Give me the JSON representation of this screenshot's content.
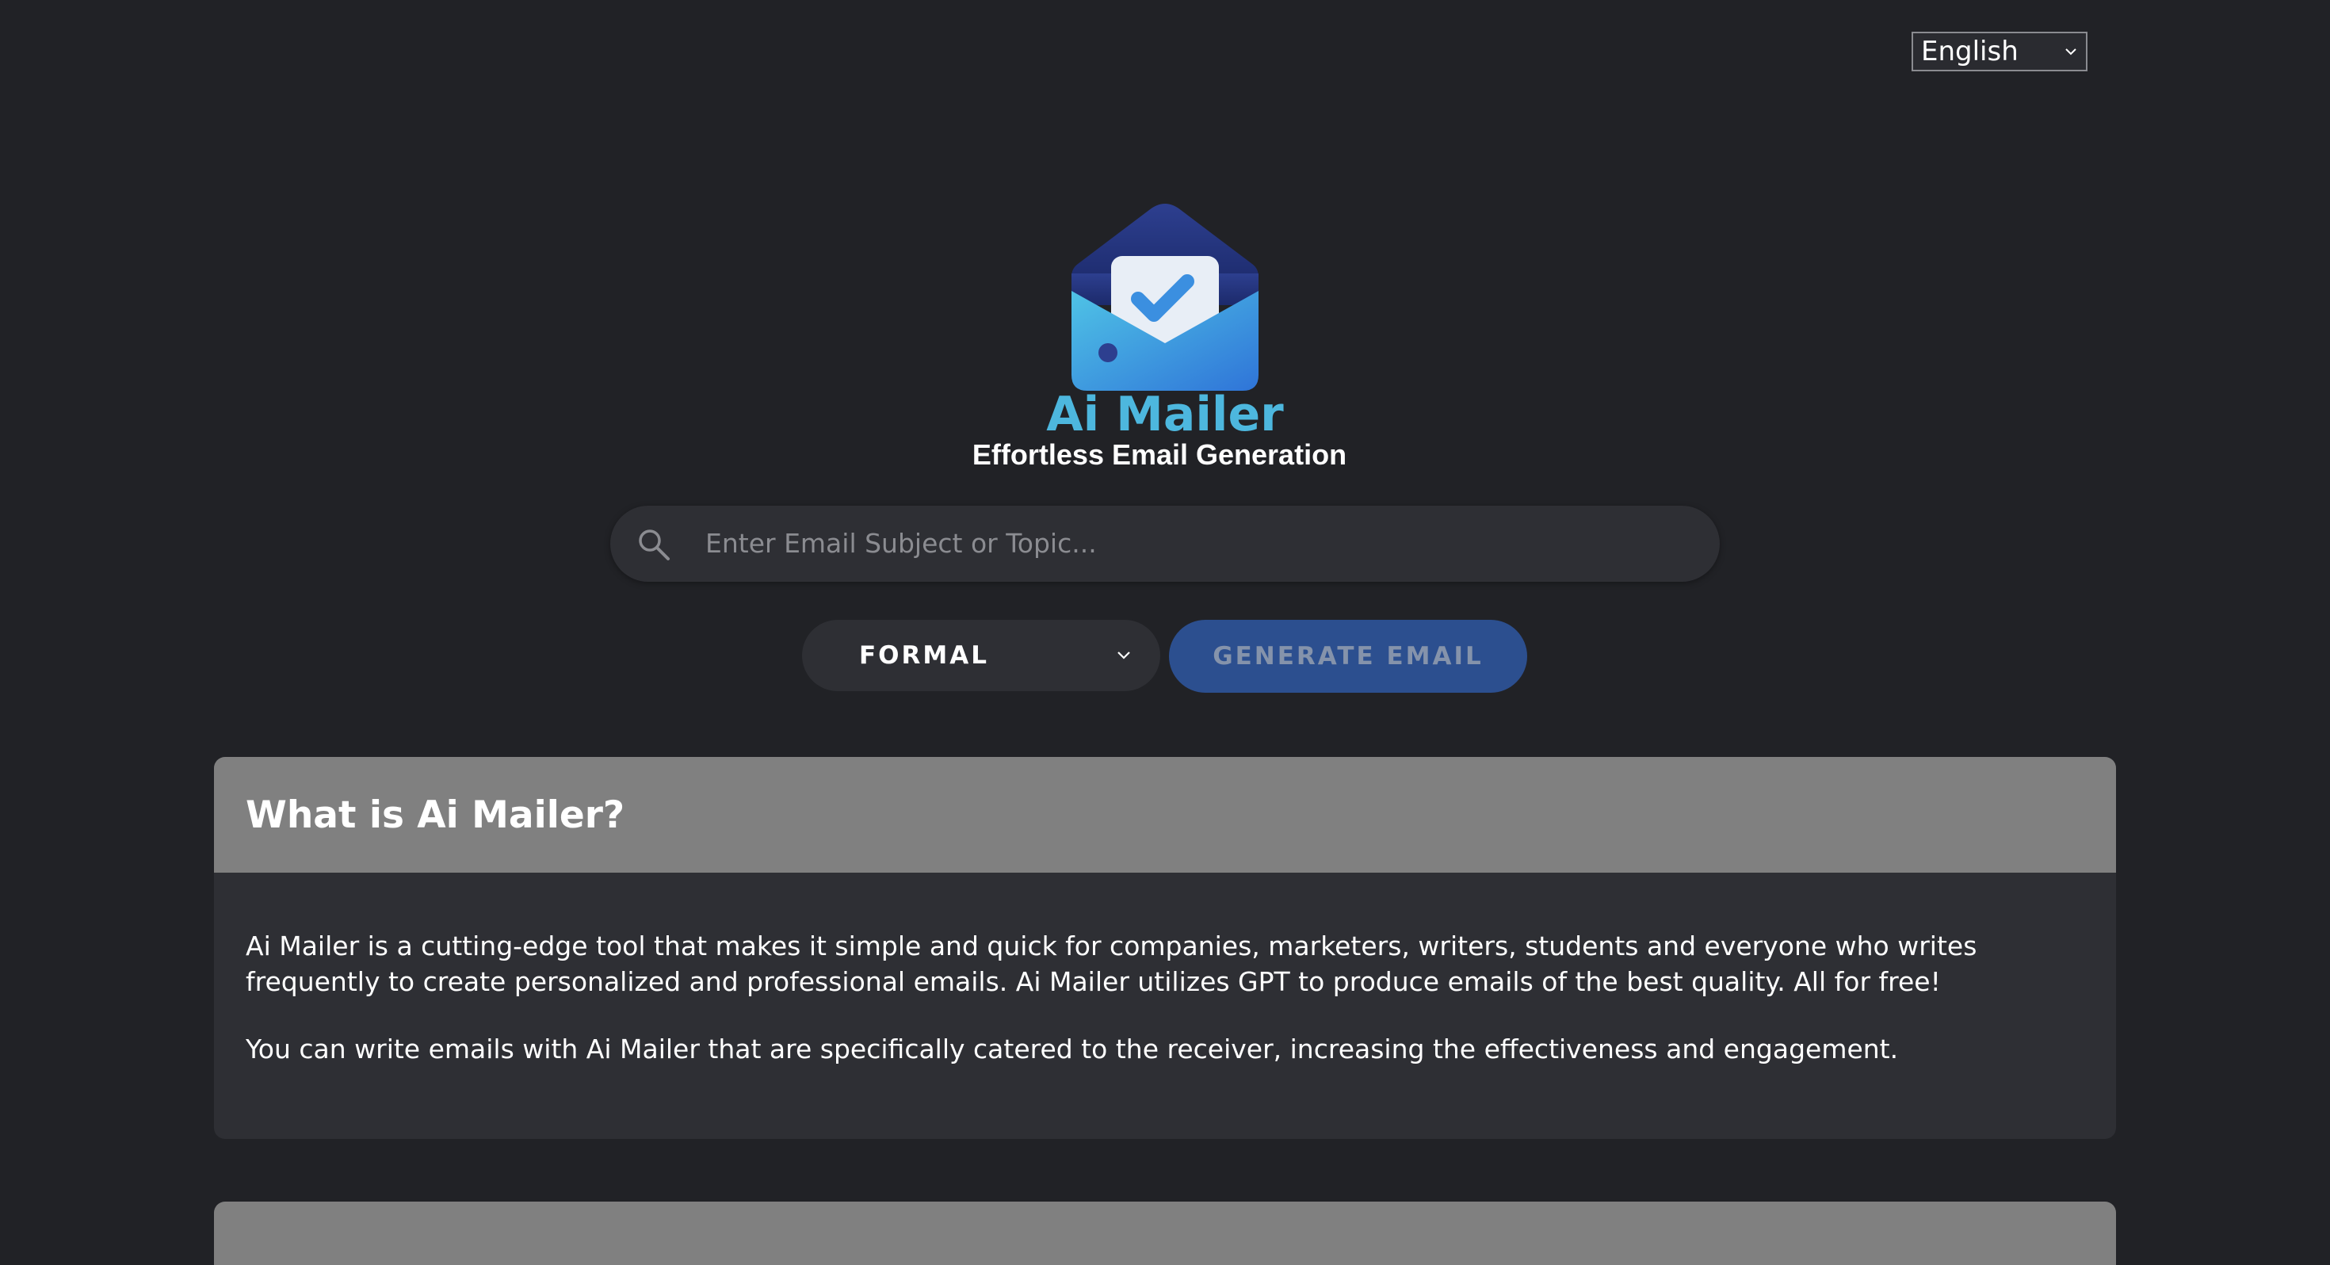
{
  "language": {
    "selected": "English"
  },
  "brand": {
    "name": "Ai Mailer",
    "tagline": "Effortless Email Generation"
  },
  "search": {
    "placeholder": "Enter Email Subject or Topic..."
  },
  "tone": {
    "selected": "FORMAL"
  },
  "actions": {
    "generate_label": "GENERATE EMAIL"
  },
  "about": {
    "title": "What is Ai Mailer?",
    "paragraph1": "Ai Mailer is a cutting-edge tool that makes it simple and quick for companies, marketers, writers, students and everyone who writes frequently to create personalized and professional emails. Ai Mailer utilizes GPT to produce emails of the best quality. All for free!",
    "paragraph2": "You can write emails with Ai Mailer that are specifically catered to the receiver, increasing the effectiveness and engagement."
  },
  "colors": {
    "background": "#212226",
    "brand_blue": "#4db7de",
    "button_primary": "#2c4f8f",
    "card_header": "#808080",
    "card_body": "#2e2f34"
  }
}
